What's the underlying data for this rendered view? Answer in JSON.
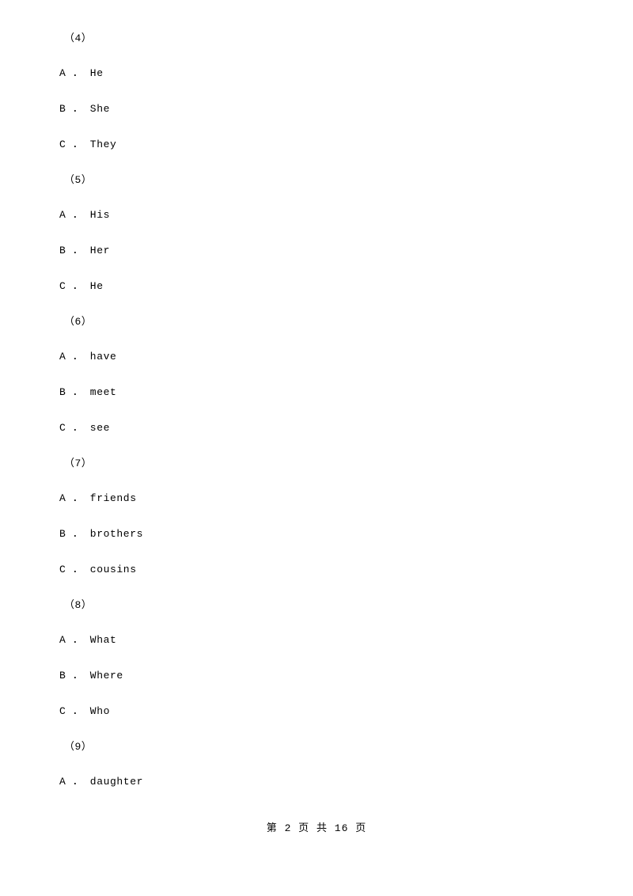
{
  "document": {
    "page_footer": {
      "prefix": "第",
      "current_page": "2",
      "middle": "页 共",
      "total_pages": "16",
      "suffix": "页",
      "full_text": "第 2 页 共 16 页"
    },
    "questions": [
      {
        "number": "（4）",
        "options": [
          "A ． He",
          "B ． She",
          "C ． They"
        ]
      },
      {
        "number": "（5）",
        "options": [
          "A ． His",
          "B ． Her",
          "C ． He"
        ]
      },
      {
        "number": "（6）",
        "options": [
          "A ． have",
          "B ． meet",
          "C ． see"
        ]
      },
      {
        "number": "（7）",
        "options": [
          "A ． friends",
          "B ． brothers",
          "C ． cousins"
        ]
      },
      {
        "number": "（8）",
        "options": [
          "A ． What",
          "B ． Where",
          "C ． Who"
        ]
      },
      {
        "number": "（9）",
        "options": [
          "A ． daughter"
        ]
      }
    ]
  }
}
